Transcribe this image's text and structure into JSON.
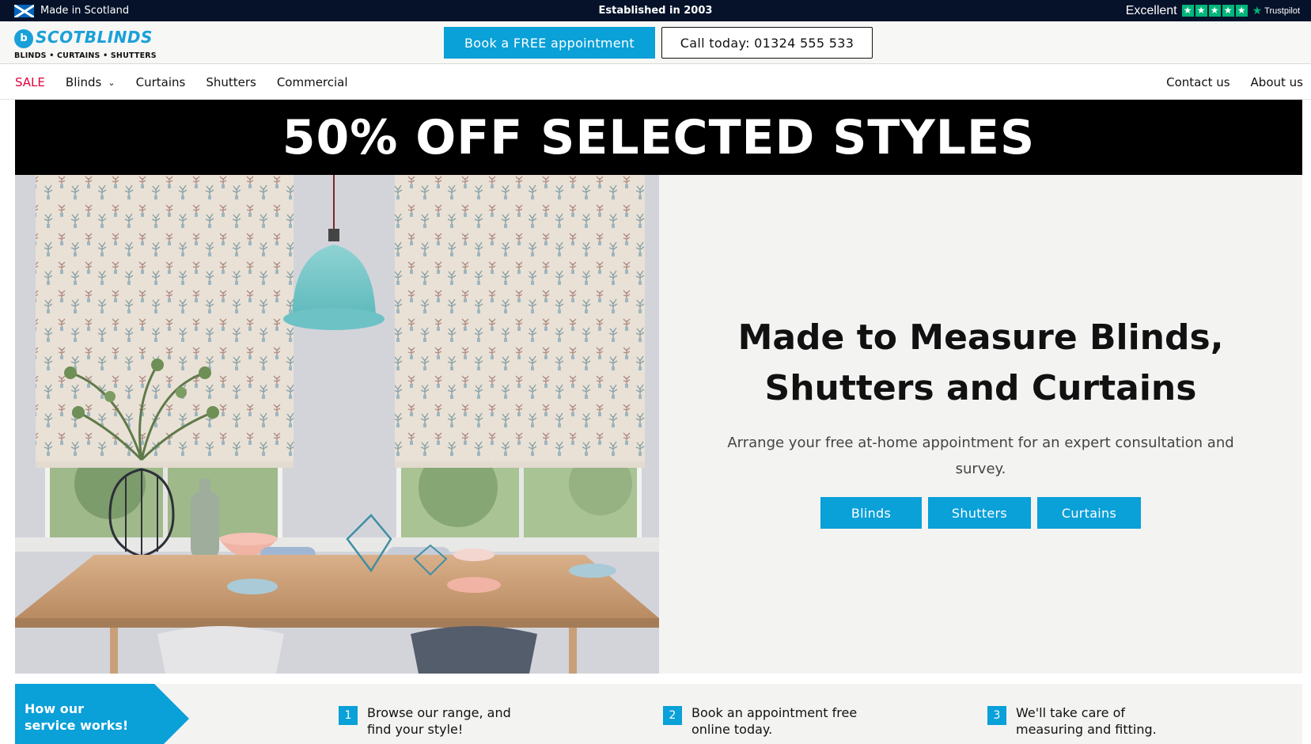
{
  "topbar": {
    "made_in": "Made in Scotland",
    "established": "Established in 2003",
    "rating_label": "Excellent",
    "trustpilot": "Trustpilot"
  },
  "header": {
    "logo_text": "SCOTBLINDS",
    "logo_tagline": "BLINDS • CURTAINS • SHUTTERS",
    "book_button": "Book a FREE appointment",
    "call_button": "Call today: 01324 555 533"
  },
  "nav": {
    "left": [
      "SALE",
      "Blinds",
      "Curtains",
      "Shutters",
      "Commercial"
    ],
    "right": [
      "Contact us",
      "About us"
    ]
  },
  "promo": {
    "headline": "50% OFF SELECTED STYLES"
  },
  "hero": {
    "title_line1": "Made to Measure Blinds,",
    "title_line2": "Shutters and Curtains",
    "subtitle": "Arrange your free at-home appointment for an expert consultation and survey.",
    "buttons": [
      "Blinds",
      "Shutters",
      "Curtains"
    ]
  },
  "how": {
    "tag_line1": "How our",
    "tag_line2": "service works!",
    "steps": [
      {
        "num": "1",
        "line1": "Browse our range, and",
        "line2": "find your style!"
      },
      {
        "num": "2",
        "line1": "Book an appointment free",
        "line2": "online today."
      },
      {
        "num": "3",
        "line1": "We'll take care of",
        "line2": "measuring and fitting."
      }
    ]
  },
  "colors": {
    "brand_blue": "#0aa0d8",
    "topbar_bg": "#05122a",
    "sale_red": "#e0003c",
    "trustpilot_green": "#00b67a"
  }
}
